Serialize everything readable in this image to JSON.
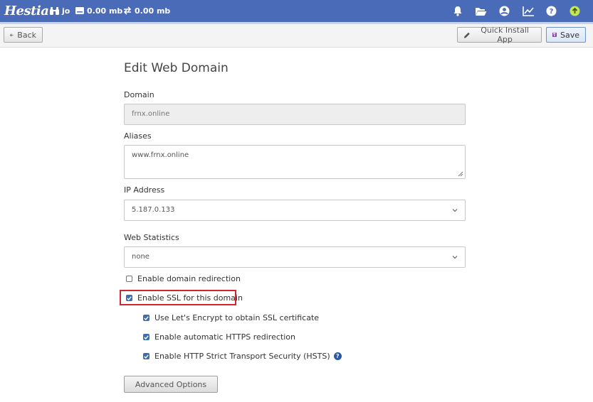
{
  "header": {
    "logo": "Hestia",
    "user": "jo",
    "disk": "0.00 mb",
    "bandwidth": "0.00 mb",
    "icons": [
      "bell-icon",
      "folder-icon",
      "user-circle-icon",
      "chart-icon",
      "help-icon",
      "update-icon"
    ]
  },
  "toolbar": {
    "back_label": "Back",
    "quick_install_label": "Quick Install App",
    "save_label": "Save"
  },
  "form": {
    "title": "Edit Web Domain",
    "domain_label": "Domain",
    "domain_value": "frnx.online",
    "aliases_label": "Aliases",
    "aliases_value": "www.frnx.online",
    "ip_label": "IP Address",
    "ip_value": "5.187.0.133",
    "stats_label": "Web Statistics",
    "stats_value": "none",
    "redirect_label": "Enable domain redirection",
    "redirect_checked": false,
    "ssl_label": "Enable SSL for this domain",
    "ssl_checked": true,
    "letsencrypt_label": "Use Let's Encrypt to obtain SSL certificate",
    "letsencrypt_checked": true,
    "https_redirect_label": "Enable automatic HTTPS redirection",
    "https_redirect_checked": true,
    "hsts_label": "Enable HTTP Strict Transport Security (HSTS)",
    "hsts_checked": true,
    "advanced_label": "Advanced Options"
  },
  "colors": {
    "topbar": "#4a6bb8",
    "accent": "#3b6db0",
    "highlight": "#d0262d"
  }
}
